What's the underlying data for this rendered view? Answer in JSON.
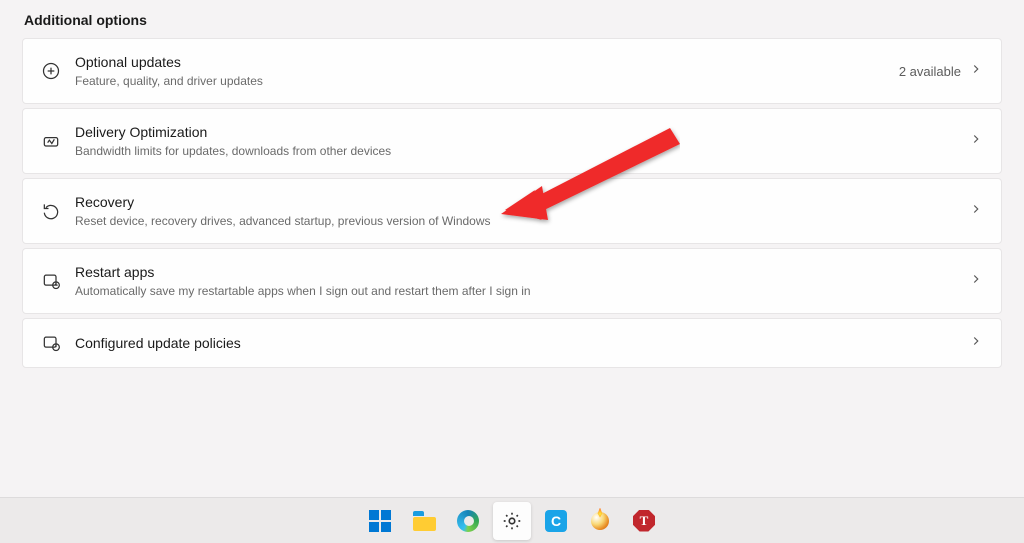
{
  "section_title": "Additional options",
  "items": [
    {
      "title": "Optional updates",
      "sub": "Feature, quality, and driver updates",
      "extra": "2 available"
    },
    {
      "title": "Delivery Optimization",
      "sub": "Bandwidth limits for updates, downloads from other devices",
      "extra": ""
    },
    {
      "title": "Recovery",
      "sub": "Reset device, recovery drives, advanced startup, previous version of Windows",
      "extra": ""
    },
    {
      "title": "Restart apps",
      "sub": "Automatically save my restartable apps when I sign out and restart them after I sign in",
      "extra": ""
    },
    {
      "title": "Configured update policies",
      "sub": "",
      "extra": ""
    }
  ],
  "taskbar": {
    "cortana_letter": "C",
    "stopsign_letter": "T"
  }
}
